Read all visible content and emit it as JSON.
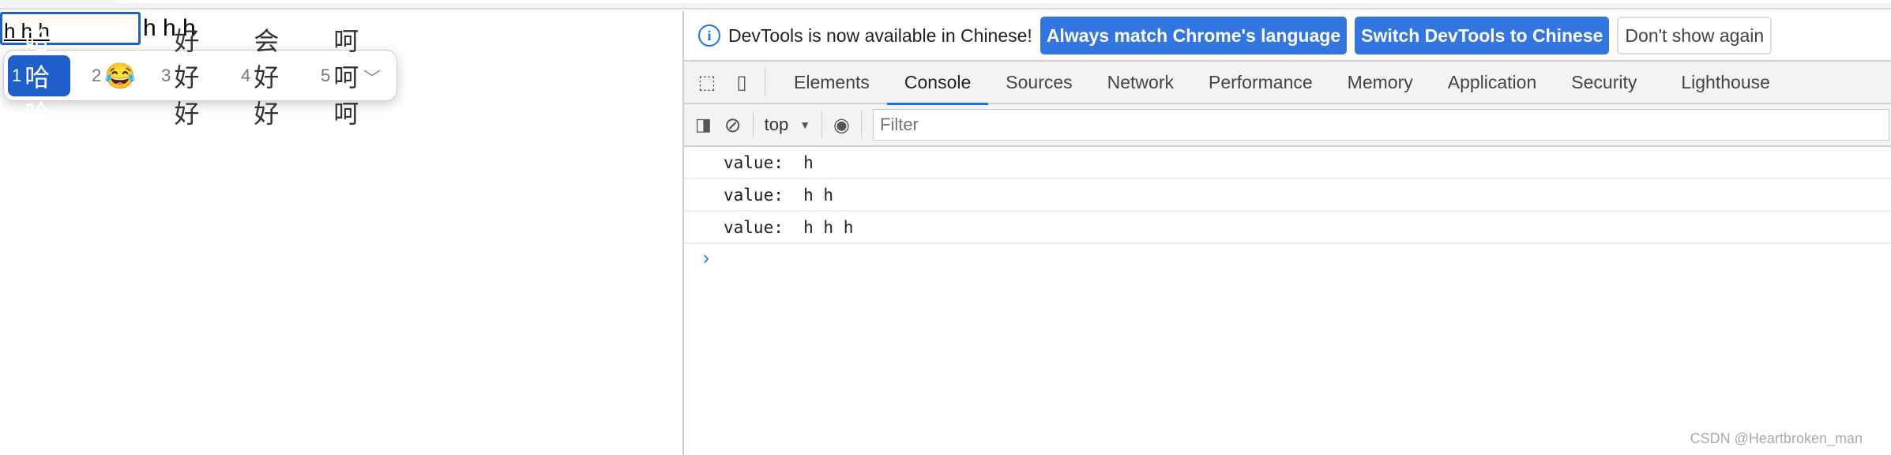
{
  "page": {
    "input_value": "h h h",
    "echo_text": "h h h"
  },
  "ime": {
    "candidates": [
      {
        "num": "1",
        "text": "哈哈哈",
        "selected": true
      },
      {
        "num": "2",
        "text": "😂"
      },
      {
        "num": "3",
        "text": "好好好"
      },
      {
        "num": "4",
        "text": "会好好"
      },
      {
        "num": "5",
        "text": "呵呵呵"
      }
    ]
  },
  "devtools": {
    "infobar": {
      "message": "DevTools is now available in Chinese!",
      "btn_match": "Always match Chrome's language",
      "btn_switch": "Switch DevTools to Chinese",
      "btn_dismiss": "Don't show again"
    },
    "tabs": [
      "Elements",
      "Console",
      "Sources",
      "Network",
      "Performance",
      "Memory",
      "Application",
      "Security",
      "Lighthouse"
    ],
    "active_tab": "Console",
    "toolbar": {
      "context": "top",
      "filter_placeholder": "Filter"
    },
    "console": [
      "value:  h",
      "value:  h h",
      "value:  h h h"
    ],
    "prompt": "›"
  },
  "watermark": "CSDN @Heartbroken_man",
  "colors": {
    "accent": "#1a73e8",
    "button": "#3476e0",
    "ime_selected": "#1f5fcc"
  }
}
